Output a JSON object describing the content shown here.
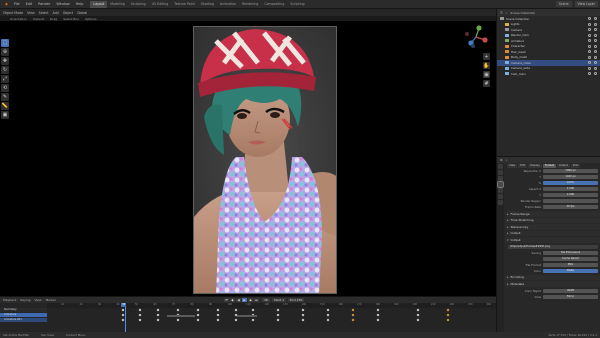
{
  "topbar": {
    "menus": [
      "File",
      "Edit",
      "Render",
      "Window",
      "Help"
    ],
    "workspaces": [
      "Layout",
      "Modeling",
      "Sculpting",
      "UV Editing",
      "Texture Paint",
      "Shading",
      "Animation",
      "Rendering",
      "Compositing",
      "Scripting"
    ],
    "active_workspace": "Layout",
    "scene_label": "Scene",
    "view_layer_label": "View Layer"
  },
  "viewport": {
    "header_items": [
      "Object Mode",
      "View",
      "Select",
      "Add",
      "Object",
      "Global"
    ],
    "header2_items": [
      "Orientation",
      "Default",
      "Drag",
      "Select Box",
      "Options"
    ],
    "tools": [
      "select-icon",
      "cursor-icon",
      "move-icon",
      "rotate-icon",
      "scale-icon",
      "transform-icon",
      "annotate-icon",
      "measure-icon",
      "add-cube-icon"
    ]
  },
  "timeline": {
    "header_items": [
      "Playback",
      "Keying",
      "View",
      "Marker"
    ],
    "frame_current": "38",
    "frame_start_label": "Start 1",
    "frame_end_label": "End 250",
    "ticks": [
      "10",
      "20",
      "30",
      "40",
      "50",
      "60",
      "70",
      "80",
      "90",
      "100",
      "110",
      "120",
      "130",
      "140",
      "150",
      "160",
      "170",
      "180",
      "190",
      "200",
      "210",
      "220",
      "230",
      "240"
    ],
    "channels": [
      "Summary",
      "Armature",
      "Armature.001"
    ]
  },
  "outliner": {
    "header": "Scene Collection",
    "rows": [
      {
        "label": "Scene Collection",
        "color": "#9a9a9a",
        "sel": false
      },
      {
        "label": "Lights",
        "color": "#d8b24a",
        "sel": false
      },
      {
        "label": "Camera",
        "color": "#9a9a9a",
        "sel": false
      },
      {
        "label": "Render_Cam",
        "color": "#7bb3d9",
        "sel": false
      },
      {
        "label": "Armature",
        "color": "#7fb06b",
        "sel": false
      },
      {
        "label": "Character",
        "color": "#e08a3a",
        "sel": false
      },
      {
        "label": "Hair_mesh",
        "color": "#e08a3a",
        "sel": false
      },
      {
        "label": "Body_mesh",
        "color": "#e08a3a",
        "sel": false
      },
      {
        "label": "Camera_close",
        "color": "#7bb3d9",
        "sel": true
      },
      {
        "label": "Camera_wide",
        "color": "#7bb3d9",
        "sel": false
      },
      {
        "label": "Cam_main",
        "color": "#7bb3d9",
        "sel": false
      }
    ]
  },
  "properties": {
    "tabs": [
      "Object",
      "Data",
      "Render",
      "Output",
      "View Layer",
      "Scene",
      "World"
    ],
    "subtabs": [
      "View",
      "Edit",
      "Display",
      "Format",
      "Output",
      "Post"
    ],
    "active_subtab": "Format",
    "rows": [
      {
        "label": "Resolution X",
        "value": "1080 px",
        "blue": false
      },
      {
        "label": "Y",
        "value": "1920 px",
        "blue": false
      },
      {
        "label": "%",
        "value": "100%",
        "blue": true
      },
      {
        "label": "Aspect X",
        "value": "1.000",
        "blue": false
      },
      {
        "label": "Y",
        "value": "1.000",
        "blue": false
      },
      {
        "label": "Render Region",
        "value": "",
        "blue": false
      },
      {
        "label": "Frame Rate",
        "value": "30 fps",
        "blue": false
      }
    ],
    "sections": [
      "Frame Range",
      "Time Stretching",
      "Stereoscopy",
      "Output"
    ],
    "output_path": "/tmp/output/frames####.png",
    "output_rows": [
      {
        "label": "Saving",
        "value": "File Extensions",
        "blue": false
      },
      {
        "label": "",
        "value": "Cache Result",
        "blue": false
      },
      {
        "label": "File Format",
        "value": "PNG",
        "blue": false
      },
      {
        "label": "Color",
        "value": "RGBA",
        "blue": true
      }
    ],
    "sections2": [
      "Encoding",
      "Metadata"
    ],
    "bottom_rows": [
      {
        "label": "Color Mgmt",
        "value": "sRGB",
        "blue": false
      },
      {
        "label": "View",
        "value": "Filmic",
        "blue": false
      }
    ]
  },
  "statusbar": {
    "left": "Set Active Modifier",
    "mid1": "Pan View",
    "mid2": "Context Menu",
    "right": "Verts 17,754 | Faces 16,221 | 3.2.1"
  }
}
